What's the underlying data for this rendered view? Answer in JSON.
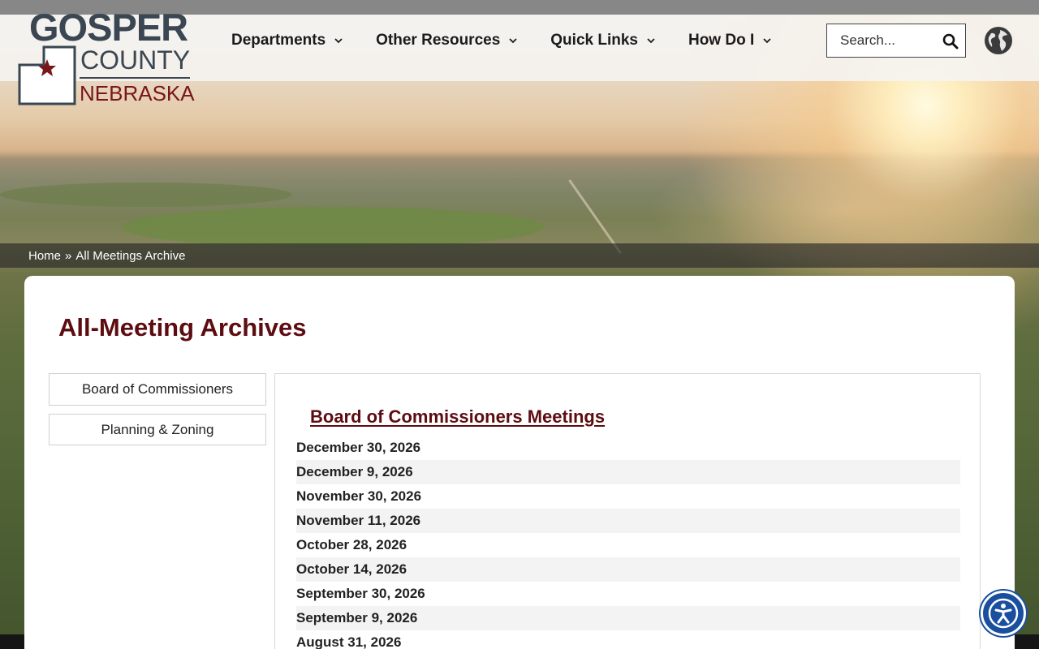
{
  "logo": {
    "line1": "GOSPER",
    "line2": "COUNTY",
    "line3": "NEBRASKA"
  },
  "nav": {
    "items": [
      {
        "label": "Departments"
      },
      {
        "label": "Other Resources"
      },
      {
        "label": "Quick Links"
      },
      {
        "label": "How Do I"
      }
    ]
  },
  "search": {
    "placeholder": "Search...",
    "icon": "search-icon"
  },
  "language": {
    "icon": "globe-icon"
  },
  "breadcrumb": {
    "home": "Home",
    "separator": "»",
    "current": "All Meetings Archive"
  },
  "page": {
    "title": "All-Meeting Archives",
    "sidebar": [
      {
        "label": "Board of Commissioners"
      },
      {
        "label": "Planning & Zoning"
      }
    ],
    "section_heading": "Board of Commissioners Meetings",
    "meetings": [
      "December 30, 2026",
      "December 9, 2026",
      "November 30, 2026",
      "November 11, 2026",
      "October 28, 2026",
      "October 14, 2026",
      "September 30, 2026",
      "September 9, 2026",
      "August 31, 2026"
    ]
  },
  "accessibility": {
    "icon": "accessibility-icon"
  },
  "colors": {
    "brand_maroon": "#5d0c11",
    "logo_slate": "#3a4651",
    "a11y_blue": "#1a4fa0"
  }
}
